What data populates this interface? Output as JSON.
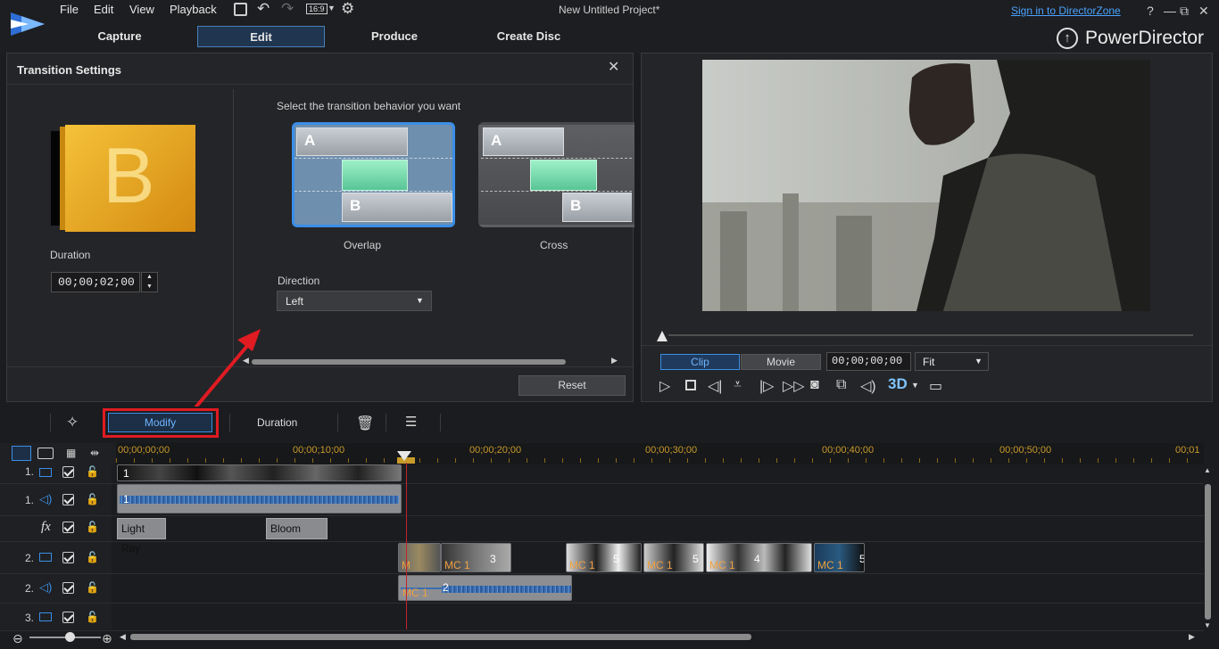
{
  "menu": {
    "file": "File",
    "edit": "Edit",
    "view": "View",
    "playback": "Playback",
    "aspect": "16:9"
  },
  "window": {
    "title": "New Untitled Project*",
    "sign_in": "Sign in to DirectorZone",
    "help": "?",
    "brand": "PowerDirector"
  },
  "tabs": {
    "capture": "Capture",
    "edit": "Edit",
    "produce": "Produce",
    "create_disc": "Create Disc"
  },
  "transition": {
    "title": "Transition Settings",
    "preview_letter": "B",
    "duration_label": "Duration",
    "duration_value": "00;00;02;00",
    "prompt": "Select the transition behavior you want",
    "options": [
      {
        "label": "Overlap",
        "a": "A",
        "b": "B",
        "selected": true
      },
      {
        "label": "Cross",
        "a": "A",
        "b": "B",
        "selected": false
      }
    ],
    "direction_label": "Direction",
    "direction_value": "Left",
    "reset": "Reset"
  },
  "preview": {
    "clip_tab": "Clip",
    "movie_tab": "Movie",
    "timecode": "00;00;00;00",
    "zoom": "Fit",
    "threed": "3D"
  },
  "toolbar": {
    "modify": "Modify",
    "duration": "Duration"
  },
  "timeline": {
    "ruler": [
      "00;00;00;00",
      "00;00;10;00",
      "00;00;20;00",
      "00;00;30;00",
      "00;00;40;00",
      "00;00;50;00",
      "00;01"
    ],
    "tracks": [
      {
        "label": "1."
      },
      {
        "label": "1."
      },
      {
        "label": "fx"
      },
      {
        "label": "2."
      },
      {
        "label": "2."
      },
      {
        "label": "3."
      }
    ],
    "fx_clips": [
      "Light Ray",
      "Bloom"
    ],
    "clip_numbers": {
      "c1": "1",
      "a1": "1",
      "a2": "2"
    },
    "mc_clips": [
      {
        "label": "MC 1",
        "num": "3"
      },
      {
        "label": "MC 1",
        "num": "5"
      },
      {
        "label": "MC 1",
        "num": "5"
      },
      {
        "label": "MC 1",
        "num": "4"
      },
      {
        "label": "MC 1",
        "num": "5"
      }
    ],
    "mc_audio": "MC 1",
    "mc_first": "M"
  },
  "colors": {
    "accent": "#3a8ee6",
    "highlight": "#e01b22",
    "ruler": "#c79a2a"
  }
}
